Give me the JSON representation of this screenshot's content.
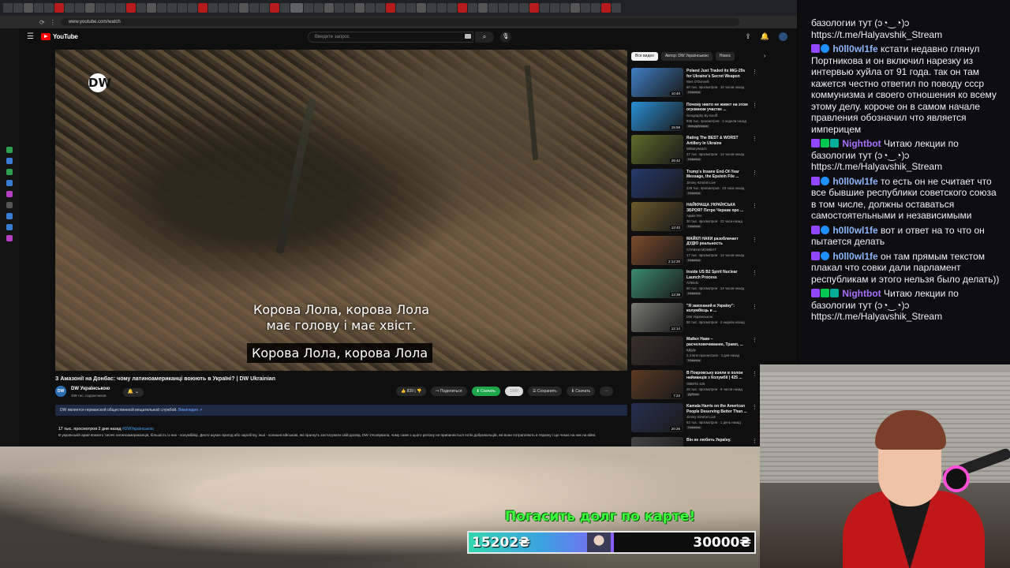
{
  "browser": {
    "url": "www.youtube.com/watch"
  },
  "youtube": {
    "logo_text": "YouTube",
    "search_placeholder": "Введите запрос",
    "video": {
      "watermark": "DW",
      "subtitle_top_line1": "Корова Лола, корова Лола",
      "subtitle_top_line2": "має голову і має хвіст.",
      "subtitle_bottom": "Корова Лола, корова Лола",
      "title": "З Амазонії на Донбас: чому латиноамериканці воюють в Україні? | DW Ukrainian",
      "channel": "DW Українською",
      "channel_avatar": "DW",
      "subscribers": "409 тис. подписчиков",
      "likes": "839",
      "share": "Поделиться",
      "download_cta": "Скачать",
      "download_tag": "1080",
      "save": "Сохранить",
      "download": "Скачать",
      "notice": "DW является германской общественной вещательной службой.",
      "notice_link": "Википедия ↗",
      "stats": "17 тыс. просмотров  2 дня назад",
      "hashtag": "#DWУкраїнською",
      "description": "В українській армії воюють тисячі латиноамериканців, більшість із них - колумбійці. Дехто шукає пригод або заробітку, інші - колишні військові, які прагнуть застосувати свій досвід. DW з'ясовувала, чому саме з цього регіону не припиняється потік добровольців, які вони потрапляють в Україну і що чекає на них на війні."
    },
    "chips": [
      "Все видео",
      "Автор: DW Українською",
      "Новос"
    ],
    "recommendations": [
      {
        "title": "Poland Just Traded its MiG-29s for Ukraine's Secret Weapon",
        "channel": "Wes O'Donnell",
        "meta": "60 тыс. просмотров · 10 часов назад",
        "badge": "Новинка",
        "duration": "10:40",
        "color": "#3d7fc4"
      },
      {
        "title": "Почему никто не живет на этом огромном участке ...",
        "channel": "Geography By Geoff",
        "meta": "935 тыс. просмотров · 2 недели назад",
        "badge": "Автодублиров",
        "duration": "15:59",
        "color": "#2a8fd6"
      },
      {
        "title": "Rating The BEST & WORST Artillery In Ukraine",
        "channel": "MilitaryWatch",
        "meta": "27 тыс. просмотров · 14 часов назад",
        "badge": "Новинка",
        "duration": "26:42",
        "color": "#5e6b2a"
      },
      {
        "title": "Trump's Insane End-Of-Year Message, the Epstein File ...",
        "channel": "Jimmy Kimmel Live",
        "meta": "229 тыс. просмотров · 23 часа назад",
        "badge": "Новинка",
        "duration": "",
        "color": "#243a6b"
      },
      {
        "title": "НАЙКРАЩА УКРАЇНСЬКА ЗБРОЯ? Петро Черник про ...",
        "channel": "Армія FM",
        "meta": "30 тыс. просмотров · 22 часа назад",
        "badge": "Новинка",
        "duration": "13:40",
        "color": "#6b5a2a"
      },
      {
        "title": "МАЙКЛ НАКИ разоблачает ДУДЮ реальность",
        "channel": "СЛАВНИ МОМЕНТ",
        "meta": "17 тыс. просмотров · 14 часов назад",
        "badge": "Новинка",
        "duration": "2:12:20",
        "color": "#7a4b2b"
      },
      {
        "title": "Inside US B2 Spirit Nuclear Launch Process",
        "channel": "AiTeleki",
        "meta": "50 тыс. просмотров · 14 часов назад",
        "badge": "Новинка",
        "duration": "13:39",
        "color": "#3b8a6e"
      },
      {
        "title": "\"Я закоханий в Україну\": колумбієць в ...",
        "channel": "DW Українською",
        "meta": "50 тыс. просмотров · 2 недели назад",
        "badge": "",
        "duration": "12:14",
        "color": "#777a70"
      },
      {
        "title": "Майкл Наки – расчеловечивание, Трамп, ...",
        "channel": "вДудь",
        "meta": "2,3 млн просмотров · 3 дня назад",
        "badge": "Новинка",
        "duration": "",
        "color": "#3a2f2a"
      },
      {
        "title": "В Покровську взяли в полон найманців з Колумбії | 425 ...",
        "channel": "OBERS 425",
        "meta": "26 тыс. просмотров · 9 часов назад",
        "badge": "Дубляж",
        "duration": "7:23",
        "color": "#5a3a22"
      },
      {
        "title": "Kamala Harris on the American People Deserving Better Than ...",
        "channel": "Jimmy Kimmel Live",
        "meta": "63 тыс. просмотров · 1 день назад",
        "badge": "Новинка",
        "duration": "20:26",
        "color": "#25304f"
      },
      {
        "title": "Він не любить Україну.",
        "channel": "",
        "meta": "",
        "badge": "",
        "duration": "",
        "color": "#444"
      }
    ]
  },
  "stream": {
    "donation_title": "Погасить долг по карте!",
    "goal_current": "15202₴",
    "goal_target": "30000₴",
    "goal_fraction": 0.507
  },
  "chat": [
    {
      "user": "",
      "text": "базологии тут (ↄ◔‿◔)ↄ https://t.me/Halyavshik_Stream",
      "badges": []
    },
    {
      "user": "h0ll0wl1fe",
      "text": "кстати недавно глянул Портникова и он включил нарезку из интервью хуйла от 91 года. так он там кажется честно ответил по поводу ссср коммунизма и своего отношения ко всему этому делу. короче он в самом начале правления обозначил что является империцем",
      "badges": [
        "purple",
        "blue"
      ]
    },
    {
      "user": "Nightbot",
      "text": "Читаю лекции по базологии тут (ↄ◔‿◔)ↄ https://t.me/Halyavshik_Stream",
      "badges": [
        "purple",
        "green",
        "teal"
      ]
    },
    {
      "user": "h0ll0wl1fe",
      "text": "то есть он не считает что все бывшие республики советского союза в том числе, должны оставаться самостоятельными и независимыми",
      "badges": [
        "purple",
        "blue"
      ]
    },
    {
      "user": "h0ll0wl1fe",
      "text": "вот и ответ на то что он пытается делать",
      "badges": [
        "purple",
        "blue"
      ]
    },
    {
      "user": "h0ll0wl1fe",
      "text": "он там прямым текстом плакал что совки дали парламент республикам и этого нельзя было делать))",
      "badges": [
        "purple",
        "blue"
      ]
    },
    {
      "user": "Nightbot",
      "text": "Читаю лекции по базологии тут (ↄ◔‿◔)ↄ https://t.me/Halyavshik_Stream",
      "badges": [
        "purple",
        "green",
        "teal"
      ]
    }
  ]
}
